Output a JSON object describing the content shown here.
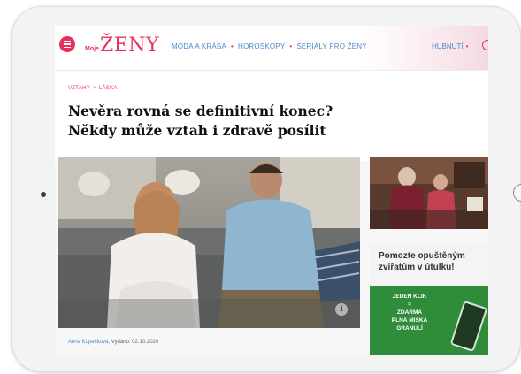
{
  "site": {
    "logo_small": "Moje",
    "logo_main": "ŽENY"
  },
  "nav": {
    "items": [
      "MÓDA A KRÁSA",
      "HOROSKOPY",
      "SERIÁLY PRO ŽENY"
    ],
    "right_item": "HUBNUTÍ"
  },
  "breadcrumb": {
    "items": [
      "VZTAHY",
      "LÁSKA"
    ],
    "separator": ">"
  },
  "article": {
    "title_line1": "Nevěra rovná se definitivní konec?",
    "title_line2": "Někdy může vztah i zdravě posílit",
    "author": "Anna Kopečková",
    "published": ", Vydáno: 02.10.2020"
  },
  "ad": {
    "title": "Pomozte opuštěným zvířatům v útulku!",
    "line1": "JEDEN KLIK",
    "line2": "=",
    "line3": "ZDARMA",
    "line4": "PLNÁ MISKA",
    "line5": "GRANULÍ"
  },
  "icons": {
    "menu": "menu-icon",
    "info": "info-icon",
    "search": "search-icon"
  },
  "colors": {
    "brand": "#e8305a",
    "nav": "#4a88c8",
    "ad_green": "#2f8c3a"
  }
}
